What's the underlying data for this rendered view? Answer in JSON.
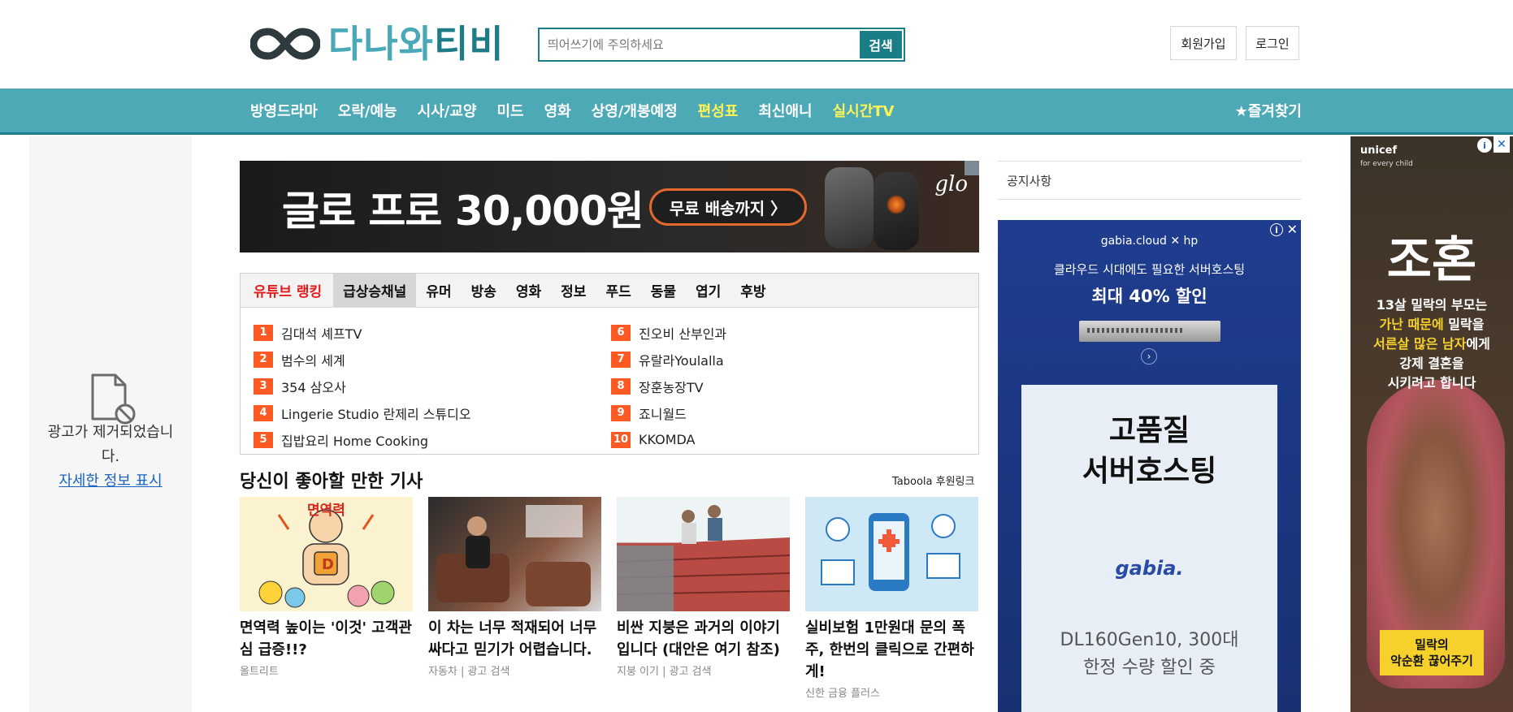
{
  "header": {
    "logo_part1": "다나와",
    "logo_part2": "티비",
    "search_placeholder": "띄어쓰기에 주의하세요",
    "search_button": "검색",
    "signup": "회원가입",
    "login": "로그인",
    "colors": {
      "brand": "#1b7d86",
      "nav": "#4ea9b7",
      "highlight": "#fff455"
    }
  },
  "nav": {
    "items": [
      {
        "label": "방영드라마",
        "highlight": false
      },
      {
        "label": "오락/예능",
        "highlight": false
      },
      {
        "label": "시사/교양",
        "highlight": false
      },
      {
        "label": "미드",
        "highlight": false
      },
      {
        "label": "영화",
        "highlight": false
      },
      {
        "label": "상영/개봉예정",
        "highlight": false
      },
      {
        "label": "편성표",
        "highlight": true
      },
      {
        "label": "최신애니",
        "highlight": false
      },
      {
        "label": "실시간TV",
        "highlight": true
      }
    ],
    "favorites": "★즐겨찾기"
  },
  "left_ad": {
    "icon": "blocked-document-icon",
    "message": "광고가 제거되었습니다.",
    "link": "자세한 정보 표시"
  },
  "banner": {
    "title": "글로 프로 30,000원",
    "cta": "무료 배송까지 〉",
    "brand": "glo"
  },
  "ranking": {
    "tabs": [
      {
        "label": "유튜브 랭킹",
        "style": "red"
      },
      {
        "label": "급상승채널",
        "style": "active"
      },
      {
        "label": "유머",
        "style": ""
      },
      {
        "label": "방송",
        "style": ""
      },
      {
        "label": "영화",
        "style": ""
      },
      {
        "label": "정보",
        "style": ""
      },
      {
        "label": "푸드",
        "style": ""
      },
      {
        "label": "동물",
        "style": ""
      },
      {
        "label": "엽기",
        "style": ""
      },
      {
        "label": "후방",
        "style": ""
      }
    ],
    "items": [
      {
        "rank": "1",
        "name": "김대석 셰프TV"
      },
      {
        "rank": "2",
        "name": "범수의 세계"
      },
      {
        "rank": "3",
        "name": "354 삼오사"
      },
      {
        "rank": "4",
        "name": "Lingerie Studio 란제리 스튜디오"
      },
      {
        "rank": "5",
        "name": "집밥요리 Home Cooking"
      },
      {
        "rank": "6",
        "name": "진오비 산부인과"
      },
      {
        "rank": "7",
        "name": "유랄라Youlalla"
      },
      {
        "rank": "8",
        "name": "장훈농장TV"
      },
      {
        "rank": "9",
        "name": "죠니월드"
      },
      {
        "rank": "10",
        "name": "KKOMDA"
      }
    ]
  },
  "articles": {
    "title": "당신이 좋아할 만한 기사",
    "sponsor": "Taboola 후원링크",
    "cards": [
      {
        "title": "면역력 높이는 '이것' 고객관심 급증!!?",
        "source": "올트리트",
        "image": "immunity-cartoon-image",
        "image_text": "면역력"
      },
      {
        "title": "이 차는 너무 적재되어 너무 싸다고 믿기가 어렵습니다.",
        "source": "자동차 | 광고 검색",
        "image": "car-interior-image"
      },
      {
        "title": "비싼 지붕은 과거의 이야기입니다 (대안은 여기 참조)",
        "source": "지붕 이기 | 광고 검색",
        "image": "roof-workers-image"
      },
      {
        "title": "실비보험 1만원대 문의 폭주, 한번의 클릭으로 간편하게!",
        "source": "신한 금융 플러스",
        "image": "insurance-phone-image"
      }
    ]
  },
  "notice": {
    "label": "공지사항"
  },
  "gabia_ad": {
    "brand": "gabia.cloud ✕ hp",
    "headline1": "클라우드 시대에도 필요한 서버호스팅",
    "headline2": "최대 40% 할인",
    "box_title": "고품질\n서버호스팅",
    "logo": "gabia.",
    "box_text": "DL160Gen10, 300대\n한정 수량 할인 중",
    "info": "i",
    "close": "✕",
    "arrow": "›"
  },
  "unicef_ad": {
    "brand": "unicef",
    "brand_sub": "for every child",
    "title": "조혼",
    "body_line1": "13살 밀락의 부모는",
    "body_line2a": "가난 때문에",
    "body_line2b": " 밀락을",
    "body_line3a": "서른살 많은 남자",
    "body_line3b": "에게",
    "body_line4": "강제 결혼을",
    "body_line5": "시키려고 합니다",
    "cta_line1": "밀락의",
    "cta_line2": "악순환 끊어주기",
    "info": "i",
    "close": "✕"
  }
}
